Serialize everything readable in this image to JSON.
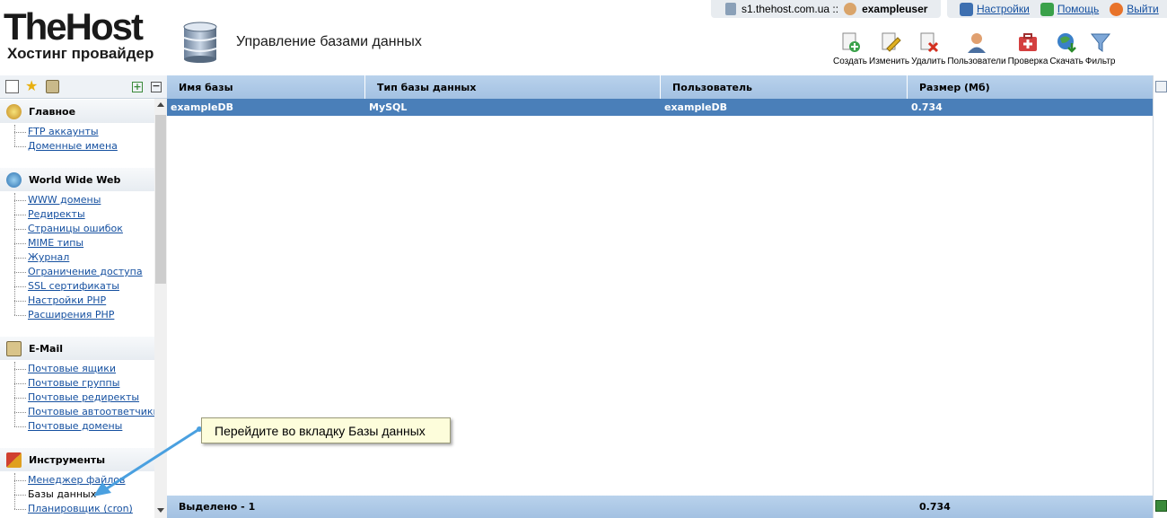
{
  "brand": {
    "name": "TheHost",
    "tagline": "Хостинг провайдер"
  },
  "page_title": "Управление базами данных",
  "session": {
    "server": "s1.thehost.com.ua ::",
    "user": "exampleuser"
  },
  "top_links": [
    {
      "label": "Настройки",
      "icon": "settings-icon"
    },
    {
      "label": "Помощь",
      "icon": "help-icon"
    },
    {
      "label": "Выйти",
      "icon": "logout-icon"
    }
  ],
  "toolbar": [
    {
      "label": "Создать",
      "icon": "create-icon"
    },
    {
      "label": "Изменить",
      "icon": "edit-icon"
    },
    {
      "label": "Удалить",
      "icon": "delete-icon"
    },
    {
      "label": "Пользователи",
      "icon": "users-icon"
    },
    {
      "label": "Проверка",
      "icon": "check-icon"
    },
    {
      "label": "Скачать",
      "icon": "download-icon"
    },
    {
      "label": "Фильтр",
      "icon": "filter-icon"
    }
  ],
  "sidebar": {
    "sections": [
      {
        "title": "Главное",
        "items": [
          "FTP аккаунты",
          "Доменные имена"
        ]
      },
      {
        "title": "World Wide Web",
        "items": [
          "WWW домены",
          "Редиректы",
          "Страницы ошибок",
          "MIME типы",
          "Журнал",
          "Ограничение доступа",
          "SSL сертификаты",
          "Настройки PHP",
          "Расширения PHP"
        ]
      },
      {
        "title": "E-Mail",
        "items": [
          "Почтовые ящики",
          "Почтовые группы",
          "Почтовые редиректы",
          "Почтовые автоответчики",
          "Почтовые домены"
        ]
      },
      {
        "title": "Инструменты",
        "items": [
          "Менеджер файлов",
          "Базы данных",
          "Планировщик (cron)"
        ]
      }
    ]
  },
  "table": {
    "columns": [
      "Имя базы",
      "Тип базы данных",
      "Пользователь",
      "Размер (Мб)"
    ],
    "rows": [
      [
        "exampleDB",
        "MySQL",
        "exampleDB",
        "0.734"
      ]
    ],
    "footer": {
      "label": "Выделено - 1",
      "total": "0.734"
    }
  },
  "tooltip": "Перейдите во вкладку Базы данных",
  "colors": {
    "header_blue": "#a3c1e2",
    "selected_row": "#4a7fb9",
    "link": "#1550a0",
    "tooltip_bg": "#fdfddb",
    "arrow": "#4aa0e0"
  }
}
